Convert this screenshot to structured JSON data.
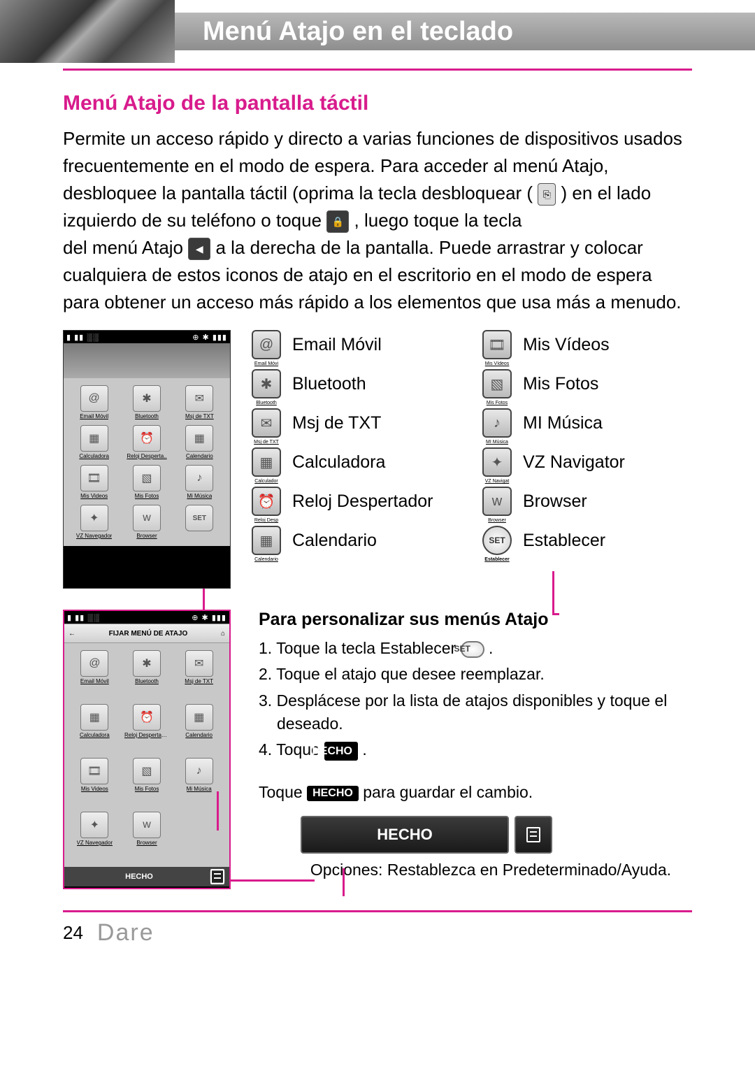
{
  "header": {
    "title": "Menú Atajo en el teclado"
  },
  "section": {
    "title": "Menú Atajo de la pantalla táctil",
    "p1a": "Permite un acceso rápido y directo a varias funciones de dispositivos usados frecuentemente en el modo de espera. Para acceder al menú Atajo, desbloquee la pantalla táctil (oprima la tecla desbloquear ( ",
    "p1b": " ) en el lado izquierdo de su teléfono o toque ",
    "p1c": ", luego toque la tecla",
    "p1d": "del menú Atajo ",
    "p1e": " a la derecha de la pantalla. Puede arrastrar y colocar cualquiera de estos iconos de atajo en el escritorio en el modo de espera para obtener un acceso más rápido a los elementos que usa más a menudo."
  },
  "shortcuts_left": [
    {
      "name": "email-movil-icon",
      "label": "Email Móvil",
      "glyph": "@"
    },
    {
      "name": "bluetooth-icon",
      "label": "Bluetooth",
      "glyph": "✱"
    },
    {
      "name": "msj-txt-icon",
      "label": "Msj de TXT",
      "glyph": "✉"
    },
    {
      "name": "calculadora-icon",
      "label": "Calculadora",
      "glyph": "▦"
    },
    {
      "name": "reloj-despertador-icon",
      "label": "Reloj Despertador",
      "glyph": "⏰"
    },
    {
      "name": "calendario-icon",
      "label": "Calendario",
      "glyph": "▦"
    }
  ],
  "shortcuts_right": [
    {
      "name": "mis-videos-icon",
      "label": "Mis Vídeos",
      "glyph": "🎞"
    },
    {
      "name": "mis-fotos-icon",
      "label": "Mis Fotos",
      "glyph": "▧"
    },
    {
      "name": "mi-musica-icon",
      "label": "MI Música",
      "glyph": "♪"
    },
    {
      "name": "vz-navigator-icon",
      "label": "VZ Navigator",
      "glyph": "✦"
    },
    {
      "name": "browser-icon",
      "label": "Browser",
      "glyph": "w"
    },
    {
      "name": "establecer-icon",
      "label": "Establecer",
      "glyph": "SET",
      "set": true
    }
  ],
  "phone1": {
    "items": [
      {
        "label": "Email Móvil",
        "glyph": "@"
      },
      {
        "label": "Bluetooth",
        "glyph": "✱"
      },
      {
        "label": "Msj de TXT",
        "glyph": "✉"
      },
      {
        "label": "Calculadora",
        "glyph": "▦"
      },
      {
        "label": "Reloj Desperta..",
        "glyph": "⏰"
      },
      {
        "label": "Calendario",
        "glyph": "▦"
      },
      {
        "label": "Mis Videos",
        "glyph": "🎞"
      },
      {
        "label": "Mis Fotos",
        "glyph": "▧"
      },
      {
        "label": "Mi Música",
        "glyph": "♪"
      },
      {
        "label": "VZ Navegador",
        "glyph": "✦"
      },
      {
        "label": "Browser",
        "glyph": "w"
      },
      {
        "label": "",
        "glyph": "SET",
        "set": true
      }
    ]
  },
  "phone2": {
    "header": "FIJAR MENÚ DE ATAJO",
    "footer": "HECHO",
    "items": [
      {
        "label": "Email Móvil",
        "glyph": "@"
      },
      {
        "label": "Bluetooth",
        "glyph": "✱"
      },
      {
        "label": "Msj de TXT",
        "glyph": "✉"
      },
      {
        "label": "Calculadora",
        "glyph": "▦"
      },
      {
        "label": "Reloj Despertador",
        "glyph": "⏰"
      },
      {
        "label": "Calendario",
        "glyph": "▦"
      },
      {
        "label": "Mis Videos",
        "glyph": "🎞"
      },
      {
        "label": "Mis Fotos",
        "glyph": "▧"
      },
      {
        "label": "Mi Música",
        "glyph": "♪"
      },
      {
        "label": "VZ Navegador",
        "glyph": "✦"
      },
      {
        "label": "Browser",
        "glyph": "w"
      }
    ]
  },
  "customize": {
    "title": "Para personalizar sus menús Atajo",
    "s1a": "1. Toque la tecla Establecer ",
    "s1b": " .",
    "s2": "2. Toque el atajo que desee reemplazar.",
    "s3": "3. Desplácese por la lista de atajos disponibles y toque el deseado.",
    "s4a": "4. Toque ",
    "s4b": " .",
    "hecho": "HECHO",
    "note_a": "Toque ",
    "note_b": " para guardar el cambio.",
    "big_hecho": "HECHO",
    "options": "Opciones: Restablezca en Predeterminado/Ayuda.",
    "set_chip": "SET"
  },
  "footer": {
    "page": "24",
    "brand": "Dare"
  }
}
